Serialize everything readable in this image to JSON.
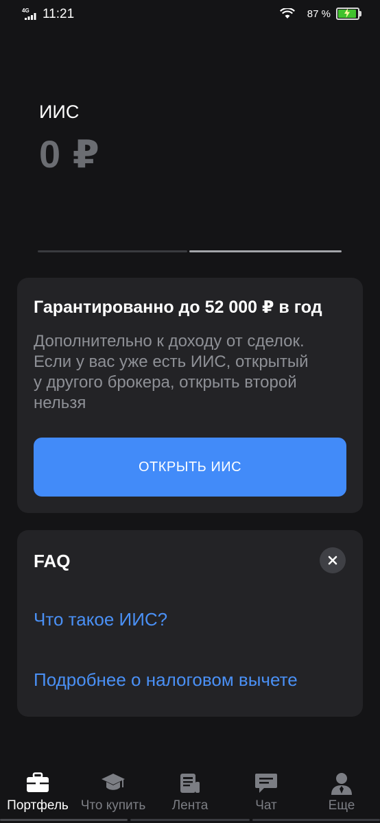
{
  "status_bar": {
    "network": "4G",
    "time": "11:21",
    "battery": "87 %"
  },
  "account": {
    "name": "ИИС",
    "balance": "0 ₽"
  },
  "pager": {
    "pages": 2,
    "active_index": 1
  },
  "promo": {
    "title": "Гарантированно до 52 000 ₽ в год",
    "description_lines": [
      "Дополнительно к доходу от сделок.",
      "Если у вас уже есть ИИС, открытый",
      "у другого брокера, открыть второй",
      "нельзя"
    ],
    "button_label": "ОТКРЫТЬ ИИС"
  },
  "faq": {
    "title": "FAQ",
    "links": [
      "Что такое ИИС?",
      "Подробнее о налоговом вычете"
    ]
  },
  "bottom_nav": {
    "items": [
      {
        "label": "Портфель",
        "icon": "briefcase-icon",
        "active": true
      },
      {
        "label": "Что купить",
        "icon": "graduation-cap-icon",
        "active": false
      },
      {
        "label": "Лента",
        "icon": "newspaper-icon",
        "active": false
      },
      {
        "label": "Чат",
        "icon": "chat-icon",
        "active": false
      },
      {
        "label": "Еще",
        "icon": "profile-icon",
        "active": false
      }
    ]
  },
  "colors": {
    "background": "#141416",
    "card": "#232326",
    "accent": "#428bf9",
    "link": "#4a90f5",
    "muted_text": "#8e9096"
  }
}
